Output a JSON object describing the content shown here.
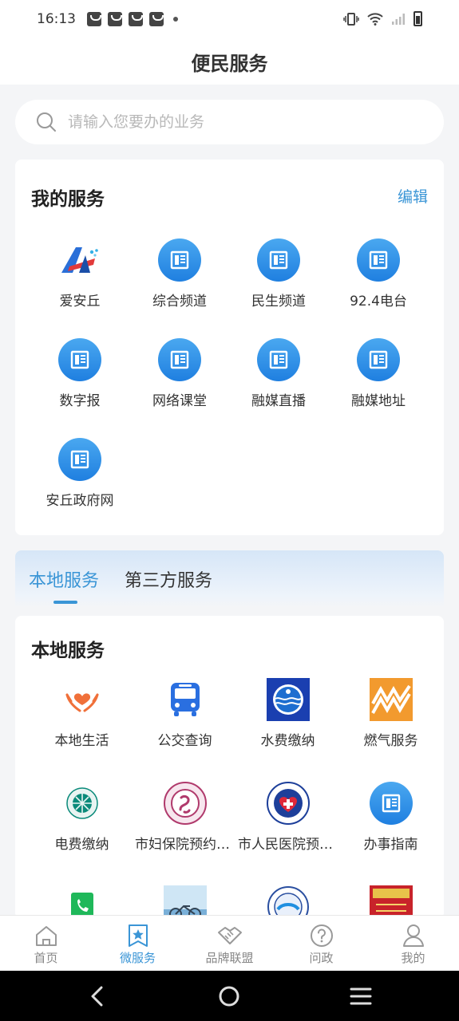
{
  "status": {
    "time": "16:13"
  },
  "header": {
    "title": "便民服务"
  },
  "search": {
    "placeholder": "请输入您要办的业务"
  },
  "my_services": {
    "title": "我的服务",
    "edit_label": "编辑",
    "items": [
      {
        "label": "爱安丘",
        "icon": "aianqiu-logo-icon"
      },
      {
        "label": "综合频道",
        "icon": "document-icon"
      },
      {
        "label": "民生频道",
        "icon": "document-icon"
      },
      {
        "label": "92.4电台",
        "icon": "document-icon"
      },
      {
        "label": "数字报",
        "icon": "document-icon"
      },
      {
        "label": "网络课堂",
        "icon": "document-icon"
      },
      {
        "label": "融媒直播",
        "icon": "document-icon"
      },
      {
        "label": "融媒地址",
        "icon": "document-icon"
      },
      {
        "label": "安丘政府网",
        "icon": "document-icon"
      }
    ]
  },
  "tabs": {
    "local": "本地服务",
    "third_party": "第三方服务",
    "active": "local"
  },
  "local_services": {
    "title": "本地服务",
    "items": [
      {
        "label": "本地生活",
        "icon": "heart-hands-icon"
      },
      {
        "label": "公交查询",
        "icon": "bus-icon"
      },
      {
        "label": "水费缴纳",
        "icon": "water-logo-icon"
      },
      {
        "label": "燃气服务",
        "icon": "gas-logo-icon"
      },
      {
        "label": "电费缴纳",
        "icon": "state-grid-logo-icon"
      },
      {
        "label": "市妇保院预约挂号",
        "icon": "maternity-hospital-logo-icon"
      },
      {
        "label": "市人民医院预约挂号",
        "icon": "peoples-hospital-logo-icon"
      },
      {
        "label": "办事指南",
        "icon": "document-icon"
      },
      {
        "label": "",
        "icon": "phone-book-icon"
      },
      {
        "label": "",
        "icon": "bike-photo-icon"
      },
      {
        "label": "",
        "icon": "round-seal-icon"
      },
      {
        "label": "",
        "icon": "hotline-12345-icon"
      }
    ]
  },
  "bottom_nav": [
    {
      "label": "首页",
      "icon": "home-icon"
    },
    {
      "label": "微服务",
      "icon": "star-bookmark-icon",
      "active": true
    },
    {
      "label": "品牌联盟",
      "icon": "handshake-icon"
    },
    {
      "label": "问政",
      "icon": "question-icon"
    },
    {
      "label": "我的",
      "icon": "user-icon"
    }
  ],
  "colors": {
    "accent": "#3a95d6",
    "icon_blue": "#2a8ae6"
  }
}
